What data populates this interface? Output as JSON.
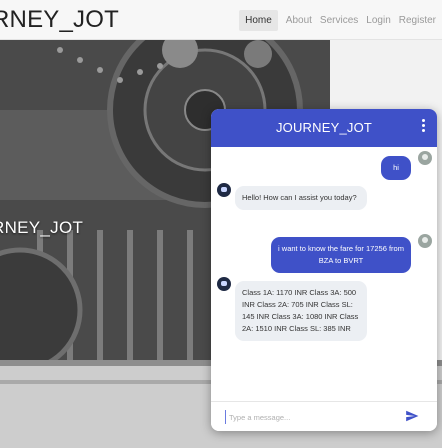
{
  "navbar": {
    "brand": "RNEY_JOT",
    "links": [
      "Home",
      "About",
      "Services",
      "Login",
      "Register"
    ]
  },
  "hero": {
    "caption": "RNEY_JOT"
  },
  "chat": {
    "title": "JOURNEY_JOT",
    "messages": [
      {
        "from": "user",
        "text": "hi"
      },
      {
        "from": "bot",
        "text": "Hello! How can I assist you today?"
      },
      {
        "from": "user",
        "text": "i want to know the fare for 17256 from BZA to BVRT"
      },
      {
        "from": "bot",
        "text": "Class 1A: 1170 INR Class 3A: 500 INR Class 2A: 705 INR Class SL: 145 INR Class 3A: 1080 INR Class 2A: 1510 INR Class SL: 385 INR"
      }
    ],
    "input_placeholder": "Type a message...",
    "accent_color": "#3f51c8"
  }
}
